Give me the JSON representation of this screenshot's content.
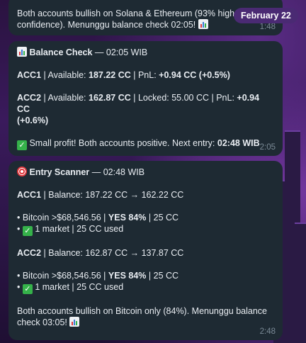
{
  "date_pill": "February 22",
  "msg1": {
    "line1": "Both accounts bullish on Solana & Ethereum (93% higher",
    "line2": "confidence). Menunggu balance check 02:05!",
    "time": "1:48"
  },
  "msg2": {
    "title": "Balance Check",
    "title_suffix": " — 02:05 WIB",
    "acc1_label": "ACC1",
    "acc1_avail_label": " | Available: ",
    "acc1_avail_value": "187.22 CC",
    "acc1_pnl_label": " | PnL: ",
    "acc1_pnl_value": "+0.94 CC (+0.5%)",
    "acc2_label": "ACC2",
    "acc2_avail_label": " | Available: ",
    "acc2_avail_value": "162.87 CC",
    "acc2_locked": " | Locked: 55.00 CC | PnL: ",
    "acc2_pnl_value": "+0.94 CC",
    "acc2_pnl_pct": "(+0.6%)",
    "summary": " Small profit! Both accounts positive. Next entry: ",
    "next_entry": "02:48 WIB",
    "time": "2:05"
  },
  "msg3": {
    "title": "Entry Scanner",
    "title_suffix": " — 02:48 WIB",
    "acc1_label": "ACC1",
    "acc1_balance": " | Balance: 187.22 CC → 162.22 CC",
    "acc1_bullet_pre": "• Bitcoin >$68,546.56 | ",
    "acc1_bullet_yes": "YES 84%",
    "acc1_bullet_post": " | 25 CC",
    "acc1_market": " 1 market | 25 CC used",
    "acc2_label": "ACC2",
    "acc2_balance": " | Balance: 162.87 CC → 137.87 CC",
    "acc2_bullet_pre": "• Bitcoin >$68,546.56 | ",
    "acc2_bullet_yes": "YES 84%",
    "acc2_bullet_post": " | 25 CC",
    "acc2_market": " 1 market | 25 CC used",
    "footer1": "Both accounts bullish on Bitcoin only (84%). Menunggu balance",
    "footer2": "check 03:05!",
    "time": "2:48"
  },
  "icons": {
    "chart": "bar-chart-icon",
    "check": "check-mark-icon",
    "target": "target-icon"
  }
}
